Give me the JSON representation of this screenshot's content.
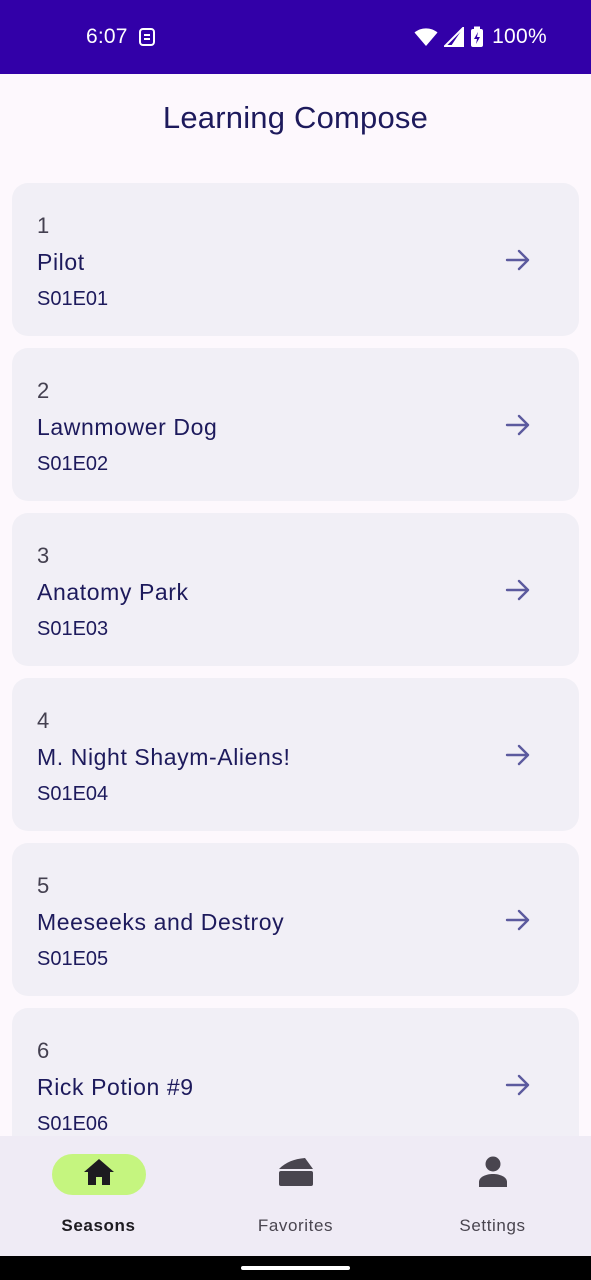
{
  "status_bar": {
    "time": "6:07",
    "battery": "100%",
    "icons": [
      "sim-card-icon",
      "wifi-icon",
      "cellular-signal-icon",
      "battery-charging-icon"
    ]
  },
  "app": {
    "title": "Learning Compose"
  },
  "episodes": [
    {
      "number": "1",
      "title": "Pilot",
      "code": "S01E01"
    },
    {
      "number": "2",
      "title": "Lawnmower Dog",
      "code": "S01E02"
    },
    {
      "number": "3",
      "title": "Anatomy Park",
      "code": "S01E03"
    },
    {
      "number": "4",
      "title": "M. Night Shaym-Aliens!",
      "code": "S01E04"
    },
    {
      "number": "5",
      "title": "Meeseeks and Destroy",
      "code": "S01E05"
    },
    {
      "number": "6",
      "title": "Rick Potion #9",
      "code": "S01E06"
    }
  ],
  "bottom_nav": {
    "items": [
      {
        "label": "Seasons",
        "icon": "home-icon",
        "active": true
      },
      {
        "label": "Favorites",
        "icon": "cake-icon",
        "active": false
      },
      {
        "label": "Settings",
        "icon": "person-icon",
        "active": false
      }
    ]
  },
  "colors": {
    "status_bar": "#3200a8",
    "title": "#1d1a5c",
    "card_background": "#f1eff6",
    "arrow": "#5c5a9e",
    "nav_active_pill": "#c5f57f"
  }
}
